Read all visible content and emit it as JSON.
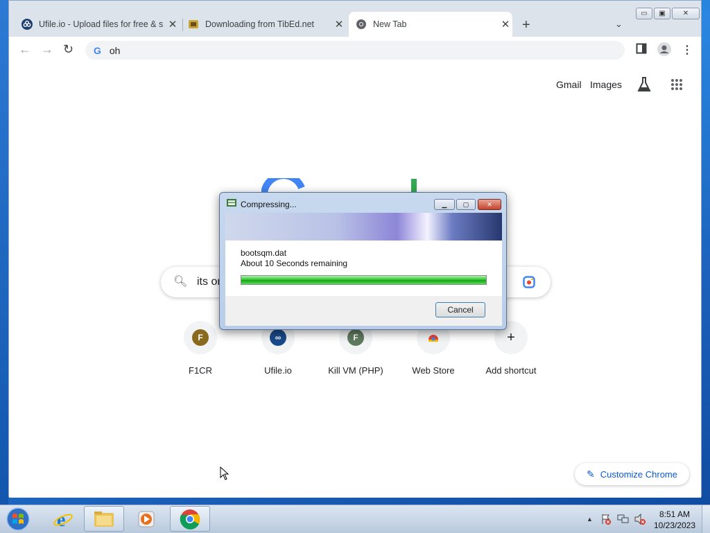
{
  "browser": {
    "tabs": [
      {
        "title": "Ufile.io - Upload files for free & s",
        "close": "✕"
      },
      {
        "title": "Downloading from TibEd.net",
        "close": "✕"
      },
      {
        "title": "New Tab",
        "close": "✕"
      }
    ],
    "new_tab": "+",
    "tab_dropdown": "⌄",
    "window_controls": {
      "minimize": "▭",
      "maximize": "▣",
      "close": "✕"
    },
    "address": {
      "text": "oh",
      "engine": "G"
    },
    "nav": {
      "back": "←",
      "forward": "→",
      "reload": "↻"
    }
  },
  "newtab": {
    "links": {
      "gmail": "Gmail",
      "images": "Images"
    },
    "search_query": "its or",
    "shortcuts": [
      {
        "label": "F1CR",
        "letter": "F",
        "color": "#8a6a1e"
      },
      {
        "label": "Ufile.io",
        "letter": "∞",
        "color": "#1a4a8a"
      },
      {
        "label": "Kill VM (PHP)",
        "letter": "F",
        "color": "#5f7a5f"
      },
      {
        "label": "Web Store",
        "letter": "",
        "color": "#ea4335"
      },
      {
        "label": "Add shortcut",
        "letter": "+",
        "color": "#f1f3f4"
      }
    ],
    "customize": "Customize Chrome"
  },
  "dialog": {
    "title": "Compressing...",
    "filename": "bootsqm.dat",
    "remaining": "About 10 Seconds remaining",
    "progress": 1.0,
    "cancel": "Cancel",
    "buttons": {
      "minimize": "▁",
      "maximize": "▢",
      "close": "✕"
    }
  },
  "taskbar": {
    "time": "8:51 AM",
    "date": "10/23/2023",
    "tray_arrow": "▲"
  }
}
